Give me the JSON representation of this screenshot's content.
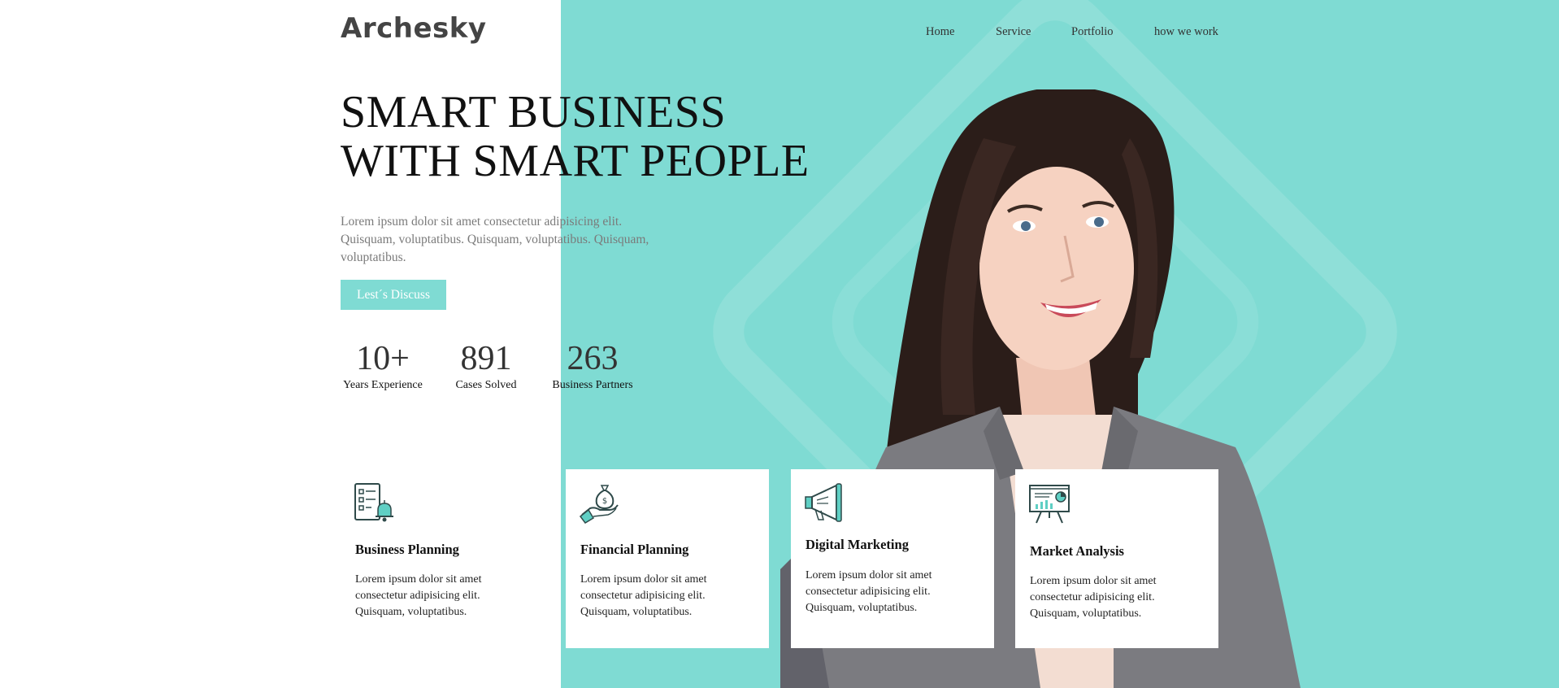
{
  "brand": {
    "logo": "Archesky"
  },
  "nav": {
    "items": [
      "Home",
      "Service",
      "Portfolio",
      "how we work"
    ]
  },
  "hero": {
    "title_line1": "SMART BUSINESS",
    "title_line2": "WITH SMART PEOPLE",
    "description": "Lorem ipsum dolor sit amet consectetur adipisicing elit. Quisquam, voluptatibus. Quisquam, voluptatibus. Quisquam, voluptatibus.",
    "cta_label": "Lest´s Discuss"
  },
  "stats": [
    {
      "value": "10+",
      "label": "Years Experience"
    },
    {
      "value": "891",
      "label": "Cases Solved"
    },
    {
      "value": "263",
      "label": "Business Partners"
    }
  ],
  "services": [
    {
      "icon": "checklist-bell-icon",
      "title": "Business Planning",
      "text": "Lorem ipsum dolor sit amet consectetur adipisicing elit. Quisquam, voluptatibus."
    },
    {
      "icon": "money-bag-hand-icon",
      "title": "Financial Planning",
      "text": "Lorem ipsum dolor sit amet consectetur adipisicing elit. Quisquam, voluptatibus."
    },
    {
      "icon": "megaphone-icon",
      "title": "Digital Marketing",
      "text": "Lorem ipsum dolor sit amet consectetur adipisicing elit. Quisquam, voluptatibus."
    },
    {
      "icon": "presentation-chart-icon",
      "title": "Market Analysis",
      "text": "Lorem ipsum dolor sit amet consectetur adipisicing elit. Quisquam, voluptatibus."
    }
  ],
  "colors": {
    "accent": "#7fdbd3",
    "icon_dark": "#2f4a4a",
    "icon_accent": "#5fcfc4"
  }
}
